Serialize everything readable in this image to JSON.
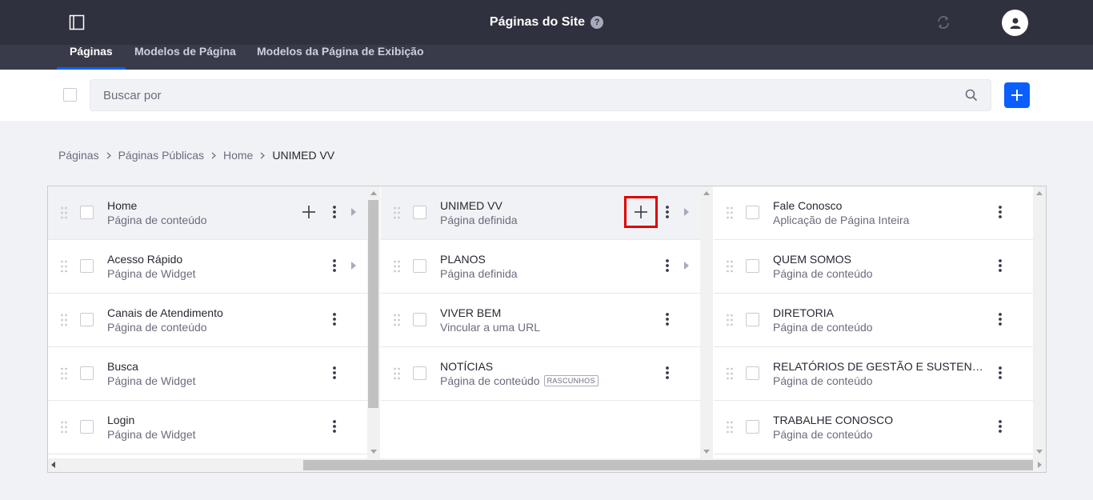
{
  "header": {
    "title": "Páginas do Site",
    "help_glyph": "?",
    "icons": [
      "sidebar-toggle-icon",
      "help-icon",
      "sync-icon",
      "user-avatar-icon"
    ]
  },
  "tabs": [
    {
      "label": "Páginas",
      "active": true
    },
    {
      "label": "Modelos de Página",
      "active": false
    },
    {
      "label": "Modelos da Página de Exibição",
      "active": false
    }
  ],
  "search": {
    "placeholder": "Buscar por",
    "value": ""
  },
  "breadcrumb": [
    "Páginas",
    "Páginas Públicas",
    "Home",
    "UNIMED VV"
  ],
  "columns": [
    {
      "items": [
        {
          "title": "Home",
          "subtitle": "Página de conteúdo",
          "selected": true,
          "has_add": true,
          "has_children": true
        },
        {
          "title": "Acesso Rápido",
          "subtitle": "Página de Widget",
          "has_children": true
        },
        {
          "title": "Canais de Atendimento",
          "subtitle": "Página de conteúdo"
        },
        {
          "title": "Busca",
          "subtitle": "Página de Widget"
        },
        {
          "title": "Login",
          "subtitle": "Página de Widget"
        }
      ]
    },
    {
      "items": [
        {
          "title": "UNIMED VV",
          "subtitle": "Página definida",
          "selected": true,
          "has_add": true,
          "highlighted": true,
          "has_children": true
        },
        {
          "title": "PLANOS",
          "subtitle": "Página definida",
          "has_children": true
        },
        {
          "title": "VIVER BEM",
          "subtitle": "Vincular a uma URL"
        },
        {
          "title": "NOTÍCIAS",
          "subtitle": "Página de conteúdo",
          "badge": "RASCUNHOS"
        }
      ]
    },
    {
      "items": [
        {
          "title": "Fale Conosco",
          "subtitle": "Aplicação de Página Inteira"
        },
        {
          "title": "QUEM SOMOS",
          "subtitle": "Página de conteúdo"
        },
        {
          "title": "DIRETORIA",
          "subtitle": "Página de conteúdo"
        },
        {
          "title": "RELATÓRIOS DE GESTÃO E SUSTENTABILIDADE",
          "subtitle": "Página de conteúdo"
        },
        {
          "title": "TRABALHE CONOSCO",
          "subtitle": "Página de conteúdo"
        }
      ]
    }
  ],
  "colors": {
    "accent": "#0b5fff",
    "topbar": "#30313f",
    "highlight_border": "#e00000"
  }
}
